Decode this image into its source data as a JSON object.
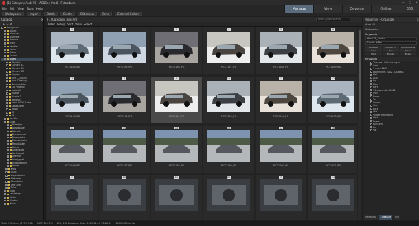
{
  "window": {
    "title": "[1] Category: Audi V8 - ACDSee Pro 8 - Fotoalbum"
  },
  "menu": [
    "File",
    "Edit",
    "View",
    "Tools",
    "Help"
  ],
  "toolbar": [
    "Workspaces",
    "Import",
    "Batch",
    "Create",
    "Slideshow",
    "Send",
    "External Editors"
  ],
  "modes": {
    "manage": "Manage",
    "view": "View",
    "develop": "Develop",
    "online": "Online",
    "ph": "365"
  },
  "left": {
    "title": "Catalog",
    "tree": [
      {
        "label": "Categories",
        "sel": false
      },
      {
        "label": "Album",
        "sel": false
      },
      {
        "label": "Albastar",
        "sel": false
      },
      {
        "label": "Blomster",
        "sel": false
      },
      {
        "label": "Bromer",
        "sel": false
      },
      {
        "label": "Fiske",
        "sel": false
      },
      {
        "label": "Familie",
        "sel": false
      },
      {
        "label": "Folder",
        "sel": false
      },
      {
        "label": "Fisker",
        "sel": false
      },
      {
        "label": "Person",
        "sel": false
      },
      {
        "label": "Bilder",
        "sel": true
      },
      {
        "label": "Blandet",
        "sel": false
      },
      {
        "label": "Citroen BX",
        "sel": false
      },
      {
        "label": "Citroen DS",
        "sel": false
      },
      {
        "label": "Citroen SM",
        "sel": false
      },
      {
        "label": "Flyplan",
        "sel": false
      },
      {
        "label": "Ford - Gnalina",
        "sel": false
      },
      {
        "label": "Ford Diesling",
        "sel": false
      },
      {
        "label": "Gammelbiler",
        "sel": false
      },
      {
        "label": "KIA Picanto",
        "sel": false
      },
      {
        "label": "Lastebil",
        "sel": false
      },
      {
        "label": "Mazda",
        "sel": false
      },
      {
        "label": "Mazda 3",
        "sel": false
      },
      {
        "label": "Renault",
        "sel": false
      },
      {
        "label": "Saab 9000 Turbo",
        "sel": false
      },
      {
        "label": "Sba Baster",
        "sel": false
      },
      {
        "label": "Volvo",
        "sel": false
      },
      {
        "label": "XB",
        "sel": false
      },
      {
        "label": "XR",
        "sel": false
      },
      {
        "label": "Familie",
        "sel": false
      },
      {
        "label": "Slekt",
        "sel": false
      },
      {
        "label": "Fiskekjer",
        "sel": false
      },
      {
        "label": "Aarsdgaget",
        "sel": false
      },
      {
        "label": "Altmein",
        "sel": false
      },
      {
        "label": "Bedsommel",
        "sel": false
      },
      {
        "label": "Blomgaden",
        "sel": false
      },
      {
        "label": "Eskuvetaalen",
        "sel": false
      },
      {
        "label": "Fiendalaket",
        "sel": false
      },
      {
        "label": "Mbear",
        "sel": false
      },
      {
        "label": "Ginaliaget",
        "sel": false
      },
      {
        "label": "Hovteoget",
        "sel": false
      },
      {
        "label": "Uterhus",
        "sel": false
      },
      {
        "label": "Varbygget",
        "sel": false
      },
      {
        "label": "Vedagaarden",
        "sel": false
      },
      {
        "label": "Vinter",
        "sel": false
      },
      {
        "label": "Kirke",
        "sel": false
      },
      {
        "label": "Gude",
        "sel": false
      },
      {
        "label": "Lagentonen",
        "sel": false
      },
      {
        "label": "Slekteler",
        "sel": false
      },
      {
        "label": "Skumbilder",
        "sel": false
      },
      {
        "label": "Test Lhel",
        "sel": false
      },
      {
        "label": "Tulse",
        "sel": false
      },
      {
        "label": "Jubel",
        "sel": false
      },
      {
        "label": "Landskap",
        "sel": false
      },
      {
        "label": "Motor",
        "sel": false
      },
      {
        "label": "Planter",
        "sel": false
      },
      {
        "label": "Natur",
        "sel": false
      }
    ],
    "tabs": [
      "Folders",
      "Catalog"
    ]
  },
  "center": {
    "path": "[1] Category: Audi V8",
    "filter_placeholder": "Filter (Quick search)",
    "subbar": [
      "Filter",
      "Group",
      "Sort",
      "View",
      "Select"
    ],
    "thumbs": [
      {
        "name": "PICT1184.JPG",
        "n": "1"
      },
      {
        "name": "PICT1185.JPG",
        "n": "2"
      },
      {
        "name": "PICT1186.JPG",
        "n": "3"
      },
      {
        "name": "PICT1187.JPG",
        "n": "4"
      },
      {
        "name": "PICT1188.JPG",
        "n": "5"
      },
      {
        "name": "PICT1189.JPG",
        "n": "6"
      },
      {
        "name": "PICT1190.JPG",
        "n": "7"
      },
      {
        "name": "PICT1191.JPG",
        "n": "8"
      },
      {
        "name": "PICT1192.JPG",
        "n": "9"
      },
      {
        "name": "PICT1193.JPG",
        "n": "10"
      },
      {
        "name": "PICT1194.JPG",
        "n": "11"
      },
      {
        "name": "PICT1195.JPG",
        "n": "12"
      },
      {
        "name": "PICT1196.JPG",
        "n": "13"
      },
      {
        "name": "PICT1197.JPG",
        "n": "14"
      },
      {
        "name": "PICT1198.JPG",
        "n": "15"
      },
      {
        "name": "PICT1199.JPG",
        "n": "16"
      },
      {
        "name": "PICT1200.JPG",
        "n": "17"
      },
      {
        "name": "PICT1201.JPG",
        "n": "18"
      },
      {
        "name": "",
        "n": "19"
      },
      {
        "name": "",
        "n": "20"
      },
      {
        "name": "",
        "n": "21"
      },
      {
        "name": "",
        "n": "22"
      },
      {
        "name": "",
        "n": "23"
      },
      {
        "name": "",
        "n": "24"
      }
    ]
  },
  "right": {
    "title": "Properties - Organize",
    "item": "Audi V8",
    "categories_label": "Categories",
    "keywords_label": "Keywords",
    "field1": "Audi V8_Folder",
    "field2": "Family & Bar",
    "presets": [
      "Rose-Red",
      "Citroen DS",
      "Citroen Rania",
      "Katie",
      "Eva",
      "Johan",
      "Marit",
      "Familie",
      "Bilder"
    ],
    "kw_title": "Keywords",
    "keywords": [
      "Thomas Holsteins jag ut",
      "Odd",
      "1 mars 2003",
      "Landheinm 2002 - Uppsala",
      "Hat",
      "Aug",
      "Ing",
      "Mas",
      "Bert",
      "11 september 2002",
      "Oleu",
      "Roker",
      "Tor",
      "Grunn",
      "Stor",
      "Bors",
      "Skit",
      "Vinderbregnering",
      "Vest",
      "Fesas",
      "Kjarlund",
      "Bu",
      "Var"
    ],
    "tabs": [
      "Metadata",
      "Organize",
      "File"
    ]
  },
  "status": {
    "total": "Total 270 items (275.1 MB)",
    "selected": "PICT1190.JPG",
    "info": "290, 1.8, Database Date: 2005-11-11 13:26:41",
    "dims": "1600x1200x24b"
  }
}
